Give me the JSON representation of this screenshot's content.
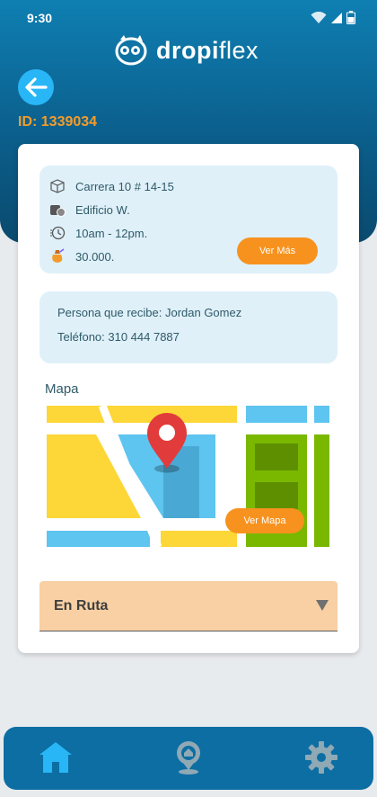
{
  "status_bar": {
    "time": "9:30"
  },
  "brand": {
    "name_bold": "dropi",
    "name_light": "flex"
  },
  "order": {
    "id_label": "ID: 1339034"
  },
  "address_box": {
    "address": "Carrera 10 # 14-15",
    "building": "Edificio W.",
    "schedule": "10am - 12pm.",
    "amount": "30.000.",
    "more_button": "Ver Más"
  },
  "recipient_box": {
    "person": "Persona que recibe: Jordan Gomez",
    "phone": "Teléfono: 310 444 7887"
  },
  "map_section": {
    "title": "Mapa",
    "map_button": "Ver Mapa"
  },
  "status_select": {
    "value": "En Ruta"
  },
  "colors": {
    "brand_blue": "#0c6ea3",
    "accent_orange": "#f7921e",
    "id_orange": "#f39c2b",
    "info_bg": "#dff0f9",
    "select_bg": "#f8d0a4",
    "active_nav": "#29b6f6"
  },
  "nav": {
    "items": [
      "home-icon",
      "map-pin-icon",
      "gear-icon"
    ],
    "active": "home-icon"
  }
}
